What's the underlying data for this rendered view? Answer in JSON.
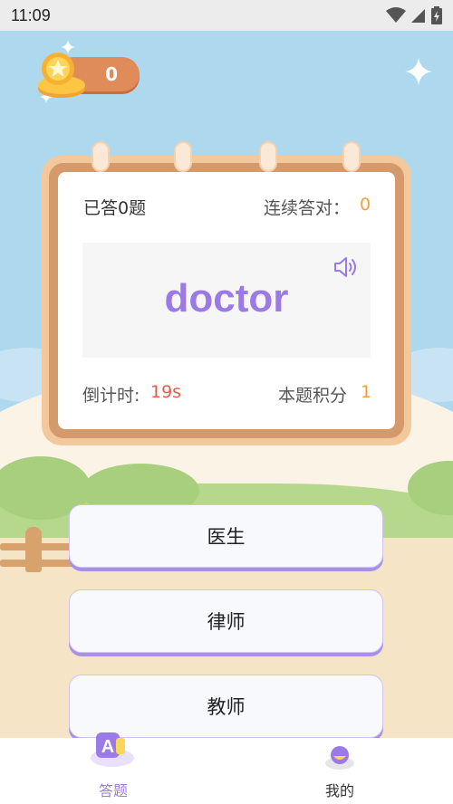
{
  "status_bar": {
    "time": "11:09"
  },
  "coins": {
    "count": "0"
  },
  "card": {
    "answered": "已答0题",
    "streak_label": "连续答对：",
    "streak_value": "0",
    "word": "doctor",
    "countdown_label": "倒计时: ",
    "countdown_value": "19s",
    "score_label": "本题积分",
    "score_value": "1"
  },
  "options": [
    {
      "label": "医生"
    },
    {
      "label": "律师"
    },
    {
      "label": "教师"
    }
  ],
  "nav": {
    "items": [
      {
        "label": "答题",
        "icon": "quiz-icon",
        "active": true
      },
      {
        "label": "我的",
        "icon": "profile-icon",
        "active": false
      }
    ]
  },
  "colors": {
    "accent": "#9b7ae5",
    "sky": "#add8ee",
    "card_frame": "#d59a6b",
    "coin_badge": "#e08c5a",
    "countdown": "#e55d4a",
    "score": "#f0a23b"
  }
}
